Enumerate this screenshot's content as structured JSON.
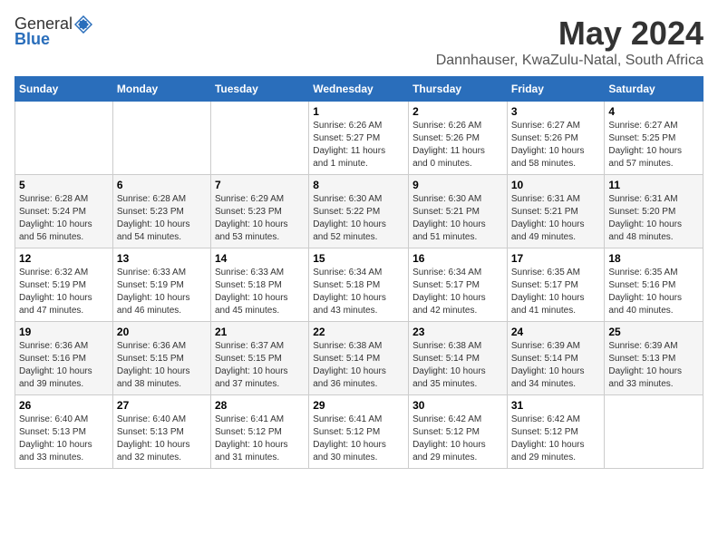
{
  "logo": {
    "general": "General",
    "blue": "Blue"
  },
  "title": "May 2024",
  "location": "Dannhauser, KwaZulu-Natal, South Africa",
  "weekdays": [
    "Sunday",
    "Monday",
    "Tuesday",
    "Wednesday",
    "Thursday",
    "Friday",
    "Saturday"
  ],
  "weeks": [
    [
      {
        "day": null,
        "info": null
      },
      {
        "day": null,
        "info": null
      },
      {
        "day": null,
        "info": null
      },
      {
        "day": "1",
        "info": "Sunrise: 6:26 AM\nSunset: 5:27 PM\nDaylight: 11 hours\nand 1 minute."
      },
      {
        "day": "2",
        "info": "Sunrise: 6:26 AM\nSunset: 5:26 PM\nDaylight: 11 hours\nand 0 minutes."
      },
      {
        "day": "3",
        "info": "Sunrise: 6:27 AM\nSunset: 5:26 PM\nDaylight: 10 hours\nand 58 minutes."
      },
      {
        "day": "4",
        "info": "Sunrise: 6:27 AM\nSunset: 5:25 PM\nDaylight: 10 hours\nand 57 minutes."
      }
    ],
    [
      {
        "day": "5",
        "info": "Sunrise: 6:28 AM\nSunset: 5:24 PM\nDaylight: 10 hours\nand 56 minutes."
      },
      {
        "day": "6",
        "info": "Sunrise: 6:28 AM\nSunset: 5:23 PM\nDaylight: 10 hours\nand 54 minutes."
      },
      {
        "day": "7",
        "info": "Sunrise: 6:29 AM\nSunset: 5:23 PM\nDaylight: 10 hours\nand 53 minutes."
      },
      {
        "day": "8",
        "info": "Sunrise: 6:30 AM\nSunset: 5:22 PM\nDaylight: 10 hours\nand 52 minutes."
      },
      {
        "day": "9",
        "info": "Sunrise: 6:30 AM\nSunset: 5:21 PM\nDaylight: 10 hours\nand 51 minutes."
      },
      {
        "day": "10",
        "info": "Sunrise: 6:31 AM\nSunset: 5:21 PM\nDaylight: 10 hours\nand 49 minutes."
      },
      {
        "day": "11",
        "info": "Sunrise: 6:31 AM\nSunset: 5:20 PM\nDaylight: 10 hours\nand 48 minutes."
      }
    ],
    [
      {
        "day": "12",
        "info": "Sunrise: 6:32 AM\nSunset: 5:19 PM\nDaylight: 10 hours\nand 47 minutes."
      },
      {
        "day": "13",
        "info": "Sunrise: 6:33 AM\nSunset: 5:19 PM\nDaylight: 10 hours\nand 46 minutes."
      },
      {
        "day": "14",
        "info": "Sunrise: 6:33 AM\nSunset: 5:18 PM\nDaylight: 10 hours\nand 45 minutes."
      },
      {
        "day": "15",
        "info": "Sunrise: 6:34 AM\nSunset: 5:18 PM\nDaylight: 10 hours\nand 43 minutes."
      },
      {
        "day": "16",
        "info": "Sunrise: 6:34 AM\nSunset: 5:17 PM\nDaylight: 10 hours\nand 42 minutes."
      },
      {
        "day": "17",
        "info": "Sunrise: 6:35 AM\nSunset: 5:17 PM\nDaylight: 10 hours\nand 41 minutes."
      },
      {
        "day": "18",
        "info": "Sunrise: 6:35 AM\nSunset: 5:16 PM\nDaylight: 10 hours\nand 40 minutes."
      }
    ],
    [
      {
        "day": "19",
        "info": "Sunrise: 6:36 AM\nSunset: 5:16 PM\nDaylight: 10 hours\nand 39 minutes."
      },
      {
        "day": "20",
        "info": "Sunrise: 6:36 AM\nSunset: 5:15 PM\nDaylight: 10 hours\nand 38 minutes."
      },
      {
        "day": "21",
        "info": "Sunrise: 6:37 AM\nSunset: 5:15 PM\nDaylight: 10 hours\nand 37 minutes."
      },
      {
        "day": "22",
        "info": "Sunrise: 6:38 AM\nSunset: 5:14 PM\nDaylight: 10 hours\nand 36 minutes."
      },
      {
        "day": "23",
        "info": "Sunrise: 6:38 AM\nSunset: 5:14 PM\nDaylight: 10 hours\nand 35 minutes."
      },
      {
        "day": "24",
        "info": "Sunrise: 6:39 AM\nSunset: 5:14 PM\nDaylight: 10 hours\nand 34 minutes."
      },
      {
        "day": "25",
        "info": "Sunrise: 6:39 AM\nSunset: 5:13 PM\nDaylight: 10 hours\nand 33 minutes."
      }
    ],
    [
      {
        "day": "26",
        "info": "Sunrise: 6:40 AM\nSunset: 5:13 PM\nDaylight: 10 hours\nand 33 minutes."
      },
      {
        "day": "27",
        "info": "Sunrise: 6:40 AM\nSunset: 5:13 PM\nDaylight: 10 hours\nand 32 minutes."
      },
      {
        "day": "28",
        "info": "Sunrise: 6:41 AM\nSunset: 5:12 PM\nDaylight: 10 hours\nand 31 minutes."
      },
      {
        "day": "29",
        "info": "Sunrise: 6:41 AM\nSunset: 5:12 PM\nDaylight: 10 hours\nand 30 minutes."
      },
      {
        "day": "30",
        "info": "Sunrise: 6:42 AM\nSunset: 5:12 PM\nDaylight: 10 hours\nand 29 minutes."
      },
      {
        "day": "31",
        "info": "Sunrise: 6:42 AM\nSunset: 5:12 PM\nDaylight: 10 hours\nand 29 minutes."
      },
      {
        "day": null,
        "info": null
      }
    ]
  ]
}
